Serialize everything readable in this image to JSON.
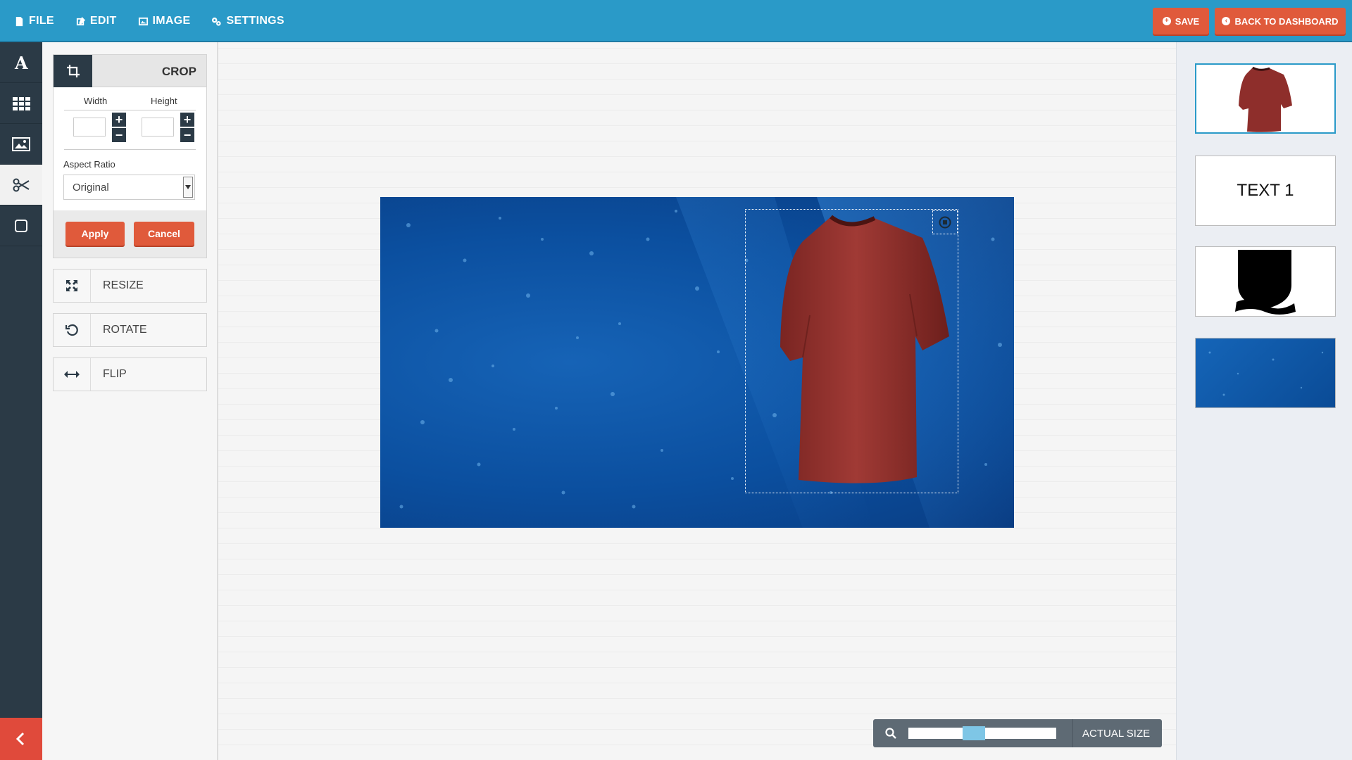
{
  "menu": [
    {
      "label": "FILE",
      "icon": "file-icon"
    },
    {
      "label": "EDIT",
      "icon": "edit-icon"
    },
    {
      "label": "IMAGE",
      "icon": "image-icon"
    },
    {
      "label": "SETTINGS",
      "icon": "settings-icon"
    }
  ],
  "top_actions": {
    "save": "SAVE",
    "back": "BACK TO DASHBOARD"
  },
  "iconbar": [
    "text-icon",
    "grid-icon",
    "image-icon",
    "scissors-icon",
    "square-icon"
  ],
  "crop": {
    "title": "CROP",
    "width_label": "Width",
    "height_label": "Height",
    "width_value": "",
    "height_value": "",
    "aspect_label": "Aspect Ratio",
    "aspect_value": "Original",
    "apply": "Apply",
    "cancel": "Cancel"
  },
  "tools": [
    {
      "label": "RESIZE",
      "icon": "resize-icon"
    },
    {
      "label": "ROTATE",
      "icon": "rotate-icon"
    },
    {
      "label": "FLIP",
      "icon": "flip-icon"
    }
  ],
  "zoom": {
    "label": "ACTUAL SIZE",
    "level": 0.45
  },
  "layers": [
    {
      "type": "image",
      "name": "t-shirt"
    },
    {
      "type": "text",
      "text": "TEXT 1"
    },
    {
      "type": "shape",
      "name": "shield"
    },
    {
      "type": "image",
      "name": "blue-background"
    }
  ],
  "colors": {
    "accent": "#2a9ac8",
    "action": "#e05a3b",
    "dark": "#2b3a46"
  }
}
